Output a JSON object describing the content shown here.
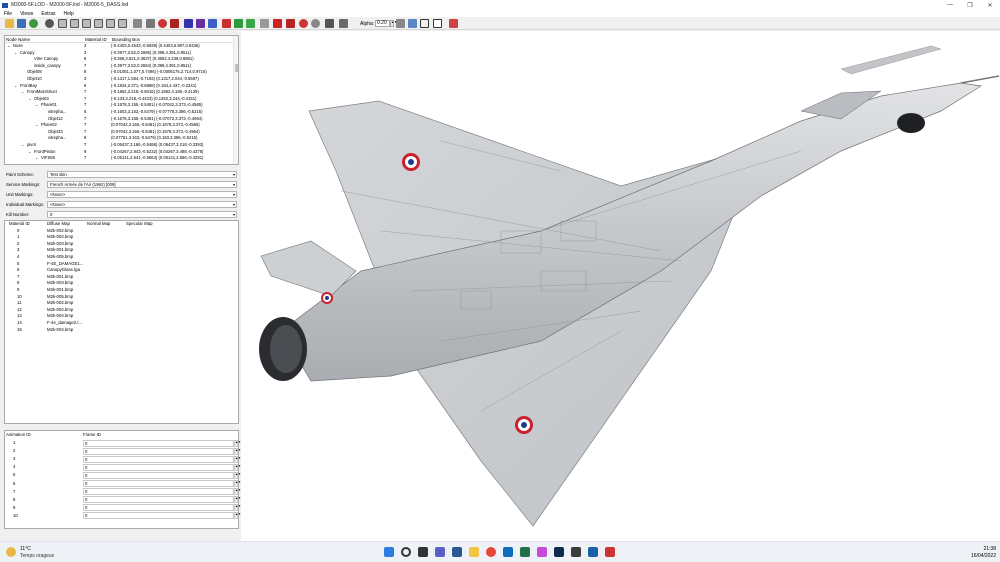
{
  "window": {
    "title": "M2000-5F.LOD - M2000-5F.lod - M2000-5_DASS.lod",
    "controls": [
      "—",
      "❐",
      "✕"
    ]
  },
  "menu": [
    "File",
    "Views",
    "Extras",
    "Help"
  ],
  "toolbar": {
    "alpha_label": "Alpha",
    "alpha_value": "0.20",
    "icons": [
      "open-icon",
      "save-icon",
      "texture-icon",
      "zoom-icon",
      "cube-front-icon",
      "cube-back-icon",
      "cube-left-icon",
      "cube-right-icon",
      "cube-top-icon",
      "cube-bottom-icon",
      "cube-iso-icon",
      "solid-icon",
      "flat-icon",
      "smooth-icon",
      "red-shade-icon",
      "blue-shade-icon",
      "purple-shade-icon",
      "blue-tex-icon",
      "red-green-icon",
      "green-tex-icon",
      "green-map-icon",
      "grid-icon",
      "red-cube-icon",
      "red-tri-icon",
      "gray-cube-icon",
      "wire-icon",
      "uv-icon",
      "select-icon",
      "layers-icon",
      "axis-icon",
      "box-icon",
      "tools-icon"
    ]
  },
  "tree": {
    "headers": [
      "Node Name",
      "Material ID",
      "Bounding Box"
    ],
    "rows": [
      {
        "indent": 0,
        "toggle": "⌄",
        "name": "Nose",
        "mat": "3",
        "bbox": "(-0.4403,0.4543,-0.6938) (0.4403,5.987,0.8436)"
      },
      {
        "indent": 1,
        "toggle": "⌄",
        "name": "Canopy",
        "mat": "3",
        "bbox": "(-0.3977,3.52,0.2685) (0.398,4.391,0.8511)"
      },
      {
        "indent": 3,
        "toggle": "",
        "name": "Vitre Canopy",
        "mat": "6",
        "bbox": "(-0.368,3.521,0.3637) (0.3682,4.238,0.8961)"
      },
      {
        "indent": 3,
        "toggle": "",
        "name": "inside_canopy",
        "mat": "7",
        "bbox": "(-0.3977,3.52,0.2654) (0.398,4.391,0.8511)"
      },
      {
        "indent": 2,
        "toggle": "",
        "name": "Objet08",
        "mat": "8",
        "bbox": "(-0.01051,1.077,0.7496) (-0.0006175,2.714,0.9716)"
      },
      {
        "indent": 2,
        "toggle": "",
        "name": "Objet10",
        "mat": "3",
        "bbox": "(-0.1317,1.584,-0.7193) (0.1317,2.044,-0.6587)"
      },
      {
        "indent": 1,
        "toggle": "⌄",
        "name": "FrontBay",
        "mat": "8",
        "bbox": "(-0.1834,2.371,-0.6888) (0.184,4.437,-0.2341)"
      },
      {
        "indent": 2,
        "toggle": "⌄",
        "name": "FrontMainStruct",
        "mat": "7",
        "bbox": "(-0.1862,3.218,-0.6015) (0.1862,4.168,-0.4139)"
      },
      {
        "indent": 3,
        "toggle": "⌄",
        "name": "Objet03",
        "mat": "7",
        "bbox": "(-0.133,3.218,-0.4423) (0.1352,3.244,-0.4151)"
      },
      {
        "indent": 4,
        "toggle": "⌄",
        "name": "Phare01",
        "mat": "7",
        "bbox": "(-0.1678,3.155,-0.5481) (-0.07042,3.373,-0.4565)"
      },
      {
        "indent": 5,
        "toggle": "",
        "name": "vitrepha...",
        "mat": "6",
        "bbox": "(-0.1603,3.163,-0.5479) (-0.07778,3.386,-0.5215)"
      },
      {
        "indent": 5,
        "toggle": "",
        "name": "Objet12",
        "mat": "7",
        "bbox": "(-0.1678,3.155,-0.5481) (-0.07072,3.373,-0.4964)"
      },
      {
        "indent": 4,
        "toggle": "⌄",
        "name": "Phare02",
        "mat": "7",
        "bbox": "(0.07042,3.155,-0.5481) (0.1678,3.373,-0.4565)"
      },
      {
        "indent": 5,
        "toggle": "",
        "name": "Objet33",
        "mat": "7",
        "bbox": "(0.07042,3.155,-0.5481) (0.1678,3.373,-0.4964)"
      },
      {
        "indent": 5,
        "toggle": "",
        "name": "vitrepha...",
        "mat": "6",
        "bbox": "(0.07751,3.163,-0.5479) (0.163,3.386,-0.5215)"
      },
      {
        "indent": 2,
        "toggle": "⌄",
        "name": "pivot",
        "mat": "7",
        "bbox": "(-0.06437,3.166,-0.5468) (0.06437,3.218,-0.3393)"
      },
      {
        "indent": 3,
        "toggle": "⌄",
        "name": "FrontPiston",
        "mat": "9",
        "bbox": "(-0.04267,2.843,-0.5232) (0.04267,3.488,-0.4378)"
      },
      {
        "indent": 4,
        "toggle": "⌄",
        "name": "VIFS55",
        "mat": "7",
        "bbox": "(-0.05141,2.641,-0.5664) (0.05141,2.886,-0.4291)"
      }
    ]
  },
  "form": {
    "paint_scheme": {
      "label": "Paint Scheme:",
      "value": "Test skin"
    },
    "service_markings": {
      "label": "Service Markings:",
      "value": "French Armée de l'Air (1962) [009]"
    },
    "unit_markings": {
      "label": "Unit Markings:",
      "value": "<None>"
    },
    "individual_markings": {
      "label": "Individual Markings:",
      "value": "<None>"
    },
    "kill_number": {
      "label": "Kill Number:",
      "value": "0"
    }
  },
  "materials": {
    "headers": [
      "Material ID",
      "Diffuse Map",
      "Normal Map",
      "Specular Map"
    ],
    "rows": [
      {
        "id": "0",
        "diffuse": "M2k-002.bmp"
      },
      {
        "id": "1",
        "diffuse": "M2k-002.bmp"
      },
      {
        "id": "2",
        "diffuse": "M2k-003.bmp"
      },
      {
        "id": "3",
        "diffuse": "M2k-001.bmp"
      },
      {
        "id": "4",
        "diffuse": "M2k-005.bmp"
      },
      {
        "id": "5",
        "diffuse": "F-4E_DAMAGE1..."
      },
      {
        "id": "6",
        "diffuse": "CanopyGlass.tga"
      },
      {
        "id": "7",
        "diffuse": "M2k-001.bmp"
      },
      {
        "id": "8",
        "diffuse": "M2k-003.bmp"
      },
      {
        "id": "9",
        "diffuse": "M2k-001.bmp"
      },
      {
        "id": "10",
        "diffuse": "M2k-005.bmp"
      },
      {
        "id": "11",
        "diffuse": "M2k-002.bmp"
      },
      {
        "id": "12",
        "diffuse": "M2k-002.bmp"
      },
      {
        "id": "13",
        "diffuse": "M2k-004.bmp"
      },
      {
        "id": "14",
        "diffuse": "F-4e_damage2.t..."
      },
      {
        "id": "15",
        "diffuse": "M2k-004.bmp"
      }
    ]
  },
  "animation": {
    "headers": [
      "Animation ID",
      "Frame ID"
    ],
    "rows": [
      {
        "id": "1",
        "frame": "0"
      },
      {
        "id": "2",
        "frame": "0"
      },
      {
        "id": "3",
        "frame": "0"
      },
      {
        "id": "4",
        "frame": "0"
      },
      {
        "id": "5",
        "frame": "0"
      },
      {
        "id": "6",
        "frame": "0"
      },
      {
        "id": "7",
        "frame": "0"
      },
      {
        "id": "8",
        "frame": "0"
      },
      {
        "id": "9",
        "frame": "0"
      },
      {
        "id": "10",
        "frame": "0"
      }
    ]
  },
  "taskbar": {
    "weather_temp": "11°C",
    "weather_desc": "Temps orageux",
    "time": "21:38",
    "date": "16/04/2022",
    "apps": [
      "start-icon",
      "search-icon",
      "taskview-icon",
      "teams-icon",
      "word-icon",
      "explorer-icon",
      "chrome-icon",
      "outlook-icon",
      "excel-icon",
      "photos-icon",
      "photoshop-icon",
      "app-icon",
      "app2-icon",
      "lod-viewer-icon"
    ]
  },
  "colors": {
    "roundel_blue": "#1a3c8f",
    "roundel_red": "#c8202c",
    "aircraft_gray": "#c9cbce",
    "background": "#ffffff"
  }
}
